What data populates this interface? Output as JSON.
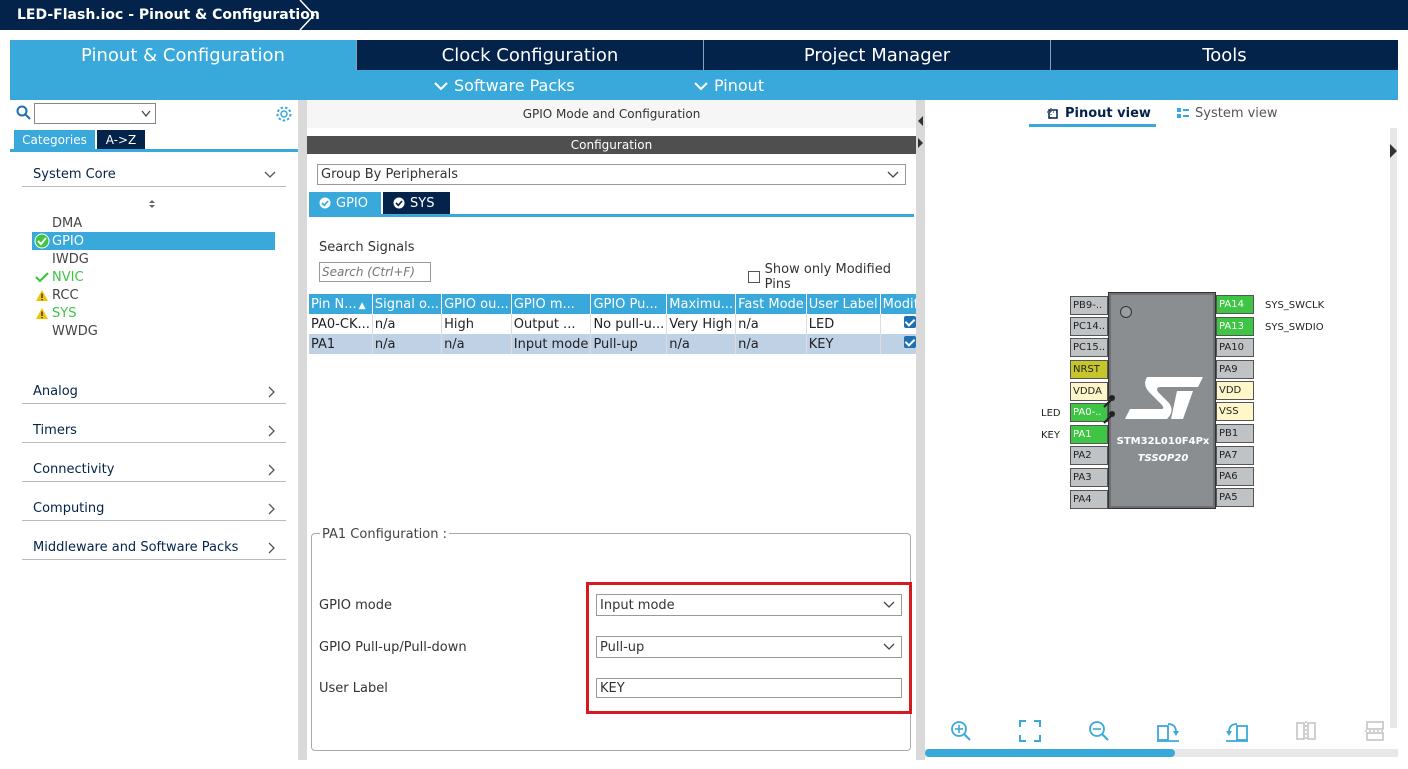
{
  "window": {
    "title": "LED-Flash.ioc - Pinout & Configuration"
  },
  "tabs": [
    {
      "label": "Pinout & Configuration"
    },
    {
      "label": "Clock Configuration"
    },
    {
      "label": "Project Manager"
    },
    {
      "label": "Tools"
    }
  ],
  "subtabs": {
    "software_packs": "Software Packs",
    "pinout": "Pinout"
  },
  "left": {
    "search_value": "",
    "tab_categories": "Categories",
    "tab_az": "A->Z",
    "system_core": "System Core",
    "items": [
      {
        "label": "DMA",
        "status": "none"
      },
      {
        "label": "GPIO",
        "status": "configured"
      },
      {
        "label": "IWDG",
        "status": "none"
      },
      {
        "label": "NVIC",
        "status": "ok"
      },
      {
        "label": "RCC",
        "status": "warning"
      },
      {
        "label": "SYS",
        "status": "warning"
      },
      {
        "label": "WWDG",
        "status": "none"
      }
    ],
    "sections": [
      "Analog",
      "Timers",
      "Connectivity",
      "Computing",
      "Middleware and Software Packs"
    ]
  },
  "middle": {
    "header": "GPIO Mode and Configuration",
    "configuration": "Configuration",
    "group_by": "Group By Peripherals",
    "ptab_gpio": "GPIO",
    "ptab_sys": "SYS",
    "search_label": "Search Signals",
    "search_placeholder": "Search (Ctrl+F)",
    "show_modified": "Show only Modified Pins",
    "columns": [
      "Pin N...",
      "Signal o...",
      "GPIO ou...",
      "GPIO m...",
      "GPIO Pu...",
      "Maximu...",
      "Fast Mode",
      "User Label",
      "Modified"
    ],
    "rows": [
      [
        "PA0-CK...",
        "n/a",
        "High",
        "Output ...",
        "No pull-u...",
        "Very High",
        "n/a",
        "LED",
        true
      ],
      [
        "PA1",
        "n/a",
        "n/a",
        "Input mode",
        "Pull-up",
        "n/a",
        "n/a",
        "KEY",
        true
      ]
    ],
    "pa1_config_title": "PA1 Configuration :",
    "gpio_mode_label": "GPIO mode",
    "gpio_mode_value": "Input mode",
    "pull_label": "GPIO Pull-up/Pull-down",
    "pull_value": "Pull-up",
    "user_label_label": "User Label",
    "user_label_value": "KEY"
  },
  "right": {
    "pinout_view": "Pinout view",
    "system_view": "System view",
    "chip_name": "STM32L010F4Px",
    "chip_package": "TSSOP20",
    "left_pins": [
      {
        "label": "PB9-..",
        "color": "gray"
      },
      {
        "label": "PC14..",
        "color": "gray"
      },
      {
        "label": "PC15..",
        "color": "gray"
      },
      {
        "label": "NRST",
        "color": "yellow"
      },
      {
        "label": "VDDA",
        "color": "cream"
      },
      {
        "label": "PA0-..",
        "color": "green"
      },
      {
        "label": "PA1",
        "color": "green"
      },
      {
        "label": "PA2",
        "color": "gray"
      },
      {
        "label": "PA3",
        "color": "gray"
      },
      {
        "label": "PA4",
        "color": "gray"
      }
    ],
    "right_pins": [
      {
        "label": "PA14",
        "color": "green"
      },
      {
        "label": "PA13",
        "color": "green"
      },
      {
        "label": "PA10",
        "color": "gray"
      },
      {
        "label": "PA9",
        "color": "gray"
      },
      {
        "label": "VDD",
        "color": "cream"
      },
      {
        "label": "VSS",
        "color": "cream"
      },
      {
        "label": "PB1",
        "color": "gray"
      },
      {
        "label": "PA7",
        "color": "gray"
      },
      {
        "label": "PA6",
        "color": "gray"
      },
      {
        "label": "PA5",
        "color": "gray"
      }
    ],
    "signal_swclk": "SYS_SWCLK",
    "signal_swdio": "SYS_SWDIO",
    "user_led": "LED",
    "user_key": "KEY"
  },
  "colors": {
    "navy": "#03234b",
    "accent": "#39a9dc",
    "pin_green": "#3ec543",
    "highlight_red": "#d71920"
  }
}
